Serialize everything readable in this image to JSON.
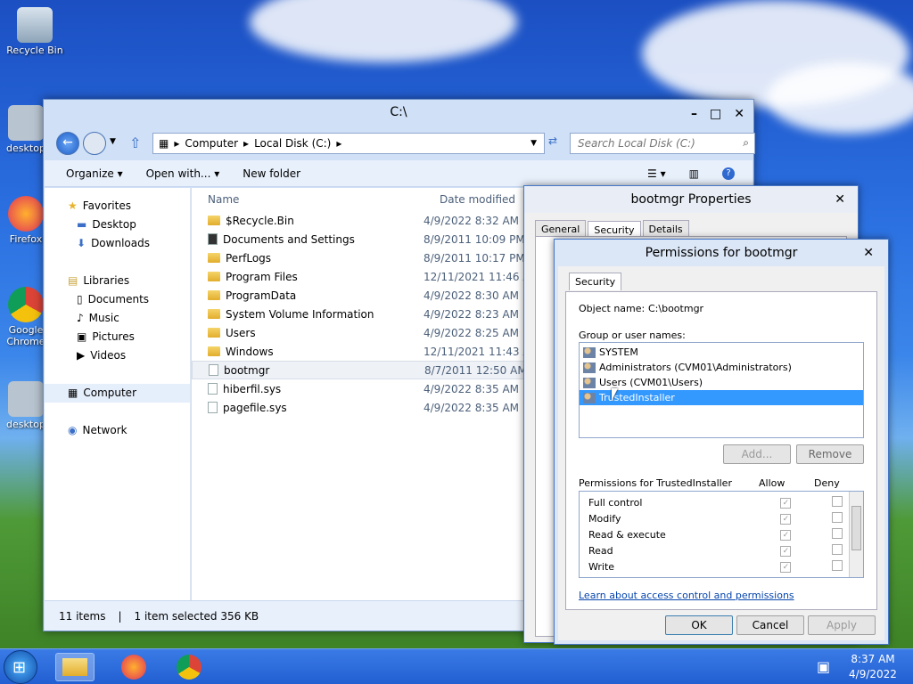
{
  "desktop": {
    "icons": [
      {
        "label": "Recycle Bin"
      },
      {
        "label": "desktop"
      },
      {
        "label": "Firefox"
      },
      {
        "label": "Google Chrome"
      },
      {
        "label": "desktop"
      }
    ]
  },
  "explorer": {
    "title": "C:\\",
    "address": {
      "crumbs": [
        "Computer",
        "Local Disk (C:)"
      ]
    },
    "search_placeholder": "Search Local Disk (C:)",
    "commands": {
      "organize": "Organize ▾",
      "open_with": "Open with... ▾",
      "new_folder": "New folder"
    },
    "nav": {
      "favorites": "Favorites",
      "desktop": "Desktop",
      "downloads": "Downloads",
      "libraries": "Libraries",
      "documents": "Documents",
      "music": "Music",
      "pictures": "Pictures",
      "videos": "Videos",
      "computer": "Computer",
      "network": "Network"
    },
    "columns": {
      "name": "Name",
      "date": "Date modified"
    },
    "files": [
      {
        "name": "$Recycle.Bin",
        "date": "4/9/2022 8:32 AM",
        "type": "folder"
      },
      {
        "name": "Documents and Settings",
        "date": "8/9/2011 10:09 PM",
        "type": "link"
      },
      {
        "name": "PerfLogs",
        "date": "8/9/2011 10:17 PM",
        "type": "folder"
      },
      {
        "name": "Program Files",
        "date": "12/11/2021 11:46 AM",
        "type": "folder"
      },
      {
        "name": "ProgramData",
        "date": "4/9/2022 8:30 AM",
        "type": "folder"
      },
      {
        "name": "System Volume Information",
        "date": "4/9/2022 8:23 AM",
        "type": "folder"
      },
      {
        "name": "Users",
        "date": "4/9/2022 8:25 AM",
        "type": "folder"
      },
      {
        "name": "Windows",
        "date": "12/11/2021 11:43 AM",
        "type": "folder"
      },
      {
        "name": "bootmgr",
        "date": "8/7/2011 12:50 AM",
        "type": "file"
      },
      {
        "name": "hiberfil.sys",
        "date": "4/9/2022 8:35 AM",
        "type": "file"
      },
      {
        "name": "pagefile.sys",
        "date": "4/9/2022 8:35 AM",
        "type": "file"
      }
    ],
    "status": {
      "count": "11 items",
      "selected": "1 item selected  356 KB"
    }
  },
  "properties": {
    "title": "bootmgr Properties",
    "tabs": [
      "General",
      "Security",
      "Details"
    ]
  },
  "permissions": {
    "title": "Permissions for bootmgr",
    "tab": "Security",
    "object_label": "Object name:",
    "object_value": "C:\\bootmgr",
    "group_label": "Group or user names:",
    "users": [
      "SYSTEM",
      "Administrators (CVM01\\Administrators)",
      "Users (CVM01\\Users)",
      "TrustedInstaller"
    ],
    "add": "Add...",
    "remove": "Remove",
    "perm_label": "Permissions for TrustedInstaller",
    "allow": "Allow",
    "deny": "Deny",
    "perms": [
      "Full control",
      "Modify",
      "Read & execute",
      "Read",
      "Write"
    ],
    "link": "Learn about access control and permissions",
    "ok": "OK",
    "cancel": "Cancel",
    "apply": "Apply"
  },
  "taskbar": {
    "time": "8:37 AM",
    "date": "4/9/2022"
  }
}
